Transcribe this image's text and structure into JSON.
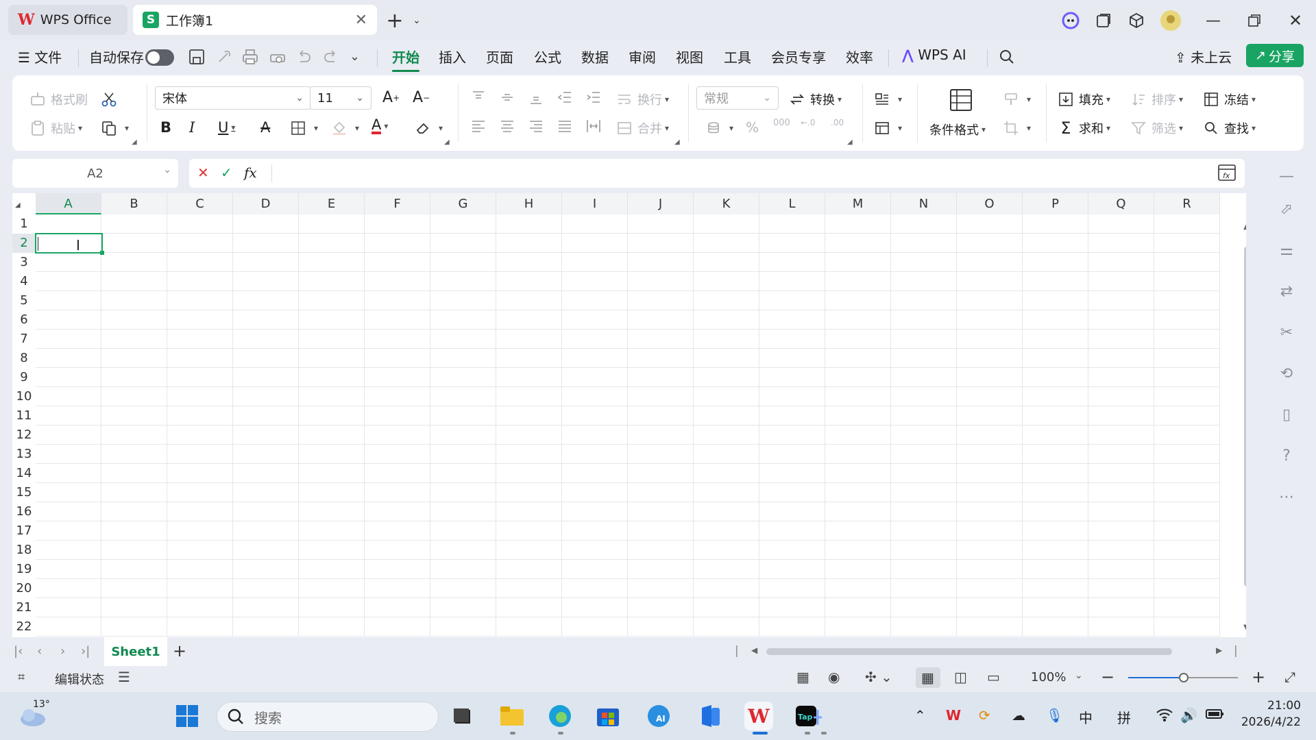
{
  "tabs": {
    "wps_label": "WPS Office",
    "book_label": "工作簿1"
  },
  "menu": {
    "file": "文件",
    "autosave": "自动保存",
    "items": [
      "开始",
      "插入",
      "页面",
      "公式",
      "数据",
      "审阅",
      "视图",
      "工具",
      "会员专享",
      "效率"
    ],
    "active": "开始",
    "ai": "WPS AI",
    "cloud": "未上云",
    "share": "分享"
  },
  "ribbon": {
    "format_painter": "格式刷",
    "paste": "粘贴",
    "font_name": "宋体",
    "font_size": "11",
    "wrap": "换行",
    "merge": "合并",
    "number_format": "常规",
    "convert": "转换",
    "cond_format": "条件格式",
    "fill": "填充",
    "sort": "排序",
    "freeze": "冻结",
    "sum": "求和",
    "filter": "筛选",
    "find": "查找",
    "bold": "B",
    "italic": "I",
    "underline": "U",
    "font_color": "A",
    "percent": "%"
  },
  "formula": {
    "cell_ref": "A2",
    "fx": "fx",
    "value": ""
  },
  "grid": {
    "columns": [
      "A",
      "B",
      "C",
      "D",
      "E",
      "F",
      "G",
      "H",
      "I",
      "J",
      "K",
      "L",
      "M",
      "N",
      "O",
      "P",
      "Q",
      "R"
    ],
    "rows": [
      "1",
      "2",
      "3",
      "4",
      "5",
      "6",
      "7",
      "8",
      "9",
      "10",
      "11",
      "12",
      "13",
      "14",
      "15",
      "16",
      "17",
      "18",
      "19",
      "20",
      "21",
      "22"
    ],
    "selected_cell": "A2"
  },
  "sheets": {
    "active": "Sheet1",
    "add": "+"
  },
  "status": {
    "mode": "编辑状态",
    "zoom": "100%"
  },
  "taskbar": {
    "weather_temp": "13°",
    "search_placeholder": "搜索",
    "ime_lang": "中",
    "ime_mode": "拼",
    "time": "21:00",
    "date": "2026/4/22"
  },
  "colors": {
    "accent": "#118a4f",
    "share_bg": "#1aa463",
    "wps_red": "#e0262f"
  }
}
